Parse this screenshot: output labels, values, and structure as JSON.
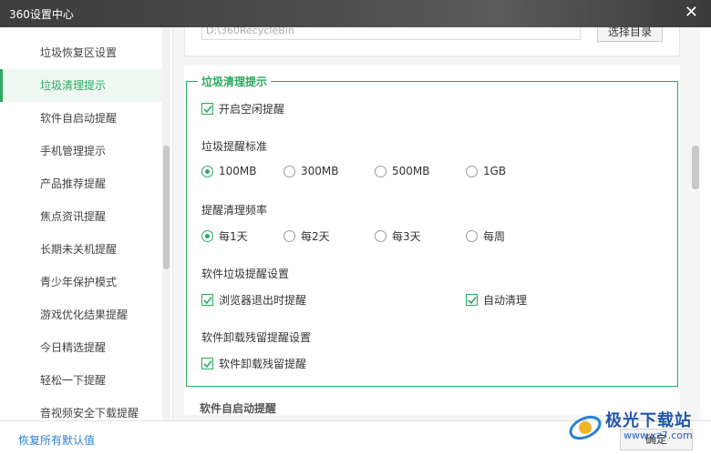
{
  "window": {
    "title": "360设置中心",
    "close_icon": "close-icon"
  },
  "sidebar": {
    "items": [
      {
        "label": "垃圾恢复区设置",
        "active": false
      },
      {
        "label": "垃圾清理提示",
        "active": true
      },
      {
        "label": "软件自启动提醒",
        "active": false
      },
      {
        "label": "手机管理提示",
        "active": false
      },
      {
        "label": "产品推荐提醒",
        "active": false
      },
      {
        "label": "焦点资讯提醒",
        "active": false
      },
      {
        "label": "长期未关机提醒",
        "active": false
      },
      {
        "label": "青少年保护模式",
        "active": false
      },
      {
        "label": "游戏优化结果提醒",
        "active": false
      },
      {
        "label": "今日精选提醒",
        "active": false
      },
      {
        "label": "轻松一下提醒",
        "active": false
      },
      {
        "label": "音视频安全下载提醒",
        "active": false
      }
    ]
  },
  "recycle": {
    "path_value": "D:\\360RecycleBin",
    "choose_button": "选择目录"
  },
  "cleanup": {
    "group_title": "垃圾清理提示",
    "enable_idle": {
      "label": "开启空闲提醒",
      "checked": true
    },
    "standard": {
      "heading": "垃圾提醒标准",
      "options": [
        {
          "label": "100MB",
          "selected": true
        },
        {
          "label": "300MB",
          "selected": false
        },
        {
          "label": "500MB",
          "selected": false
        },
        {
          "label": "1GB",
          "selected": false
        }
      ]
    },
    "frequency": {
      "heading": "提醒清理频率",
      "options": [
        {
          "label": "每1天",
          "selected": true
        },
        {
          "label": "每2天",
          "selected": false
        },
        {
          "label": "每3天",
          "selected": false
        },
        {
          "label": "每周",
          "selected": false
        }
      ]
    },
    "software_junk": {
      "heading": "软件垃圾提醒设置",
      "browser_exit": {
        "label": "浏览器退出时提醒",
        "checked": true
      },
      "auto_clean": {
        "label": "自动清理",
        "checked": true
      }
    },
    "uninstall": {
      "heading": "软件卸载残留提醒设置",
      "residual": {
        "label": "软件卸载残留提醒",
        "checked": true
      }
    }
  },
  "next_section": {
    "heading": "软件自启动提醒"
  },
  "footer": {
    "restore_defaults": "恢复所有默认值",
    "ok_button": "确定"
  },
  "watermark": {
    "text": "极光下载站",
    "url": "www.xz7.com"
  },
  "colors": {
    "accent": "#2aaa5e",
    "link": "#2a7fd4",
    "titlebar": "#444444"
  }
}
